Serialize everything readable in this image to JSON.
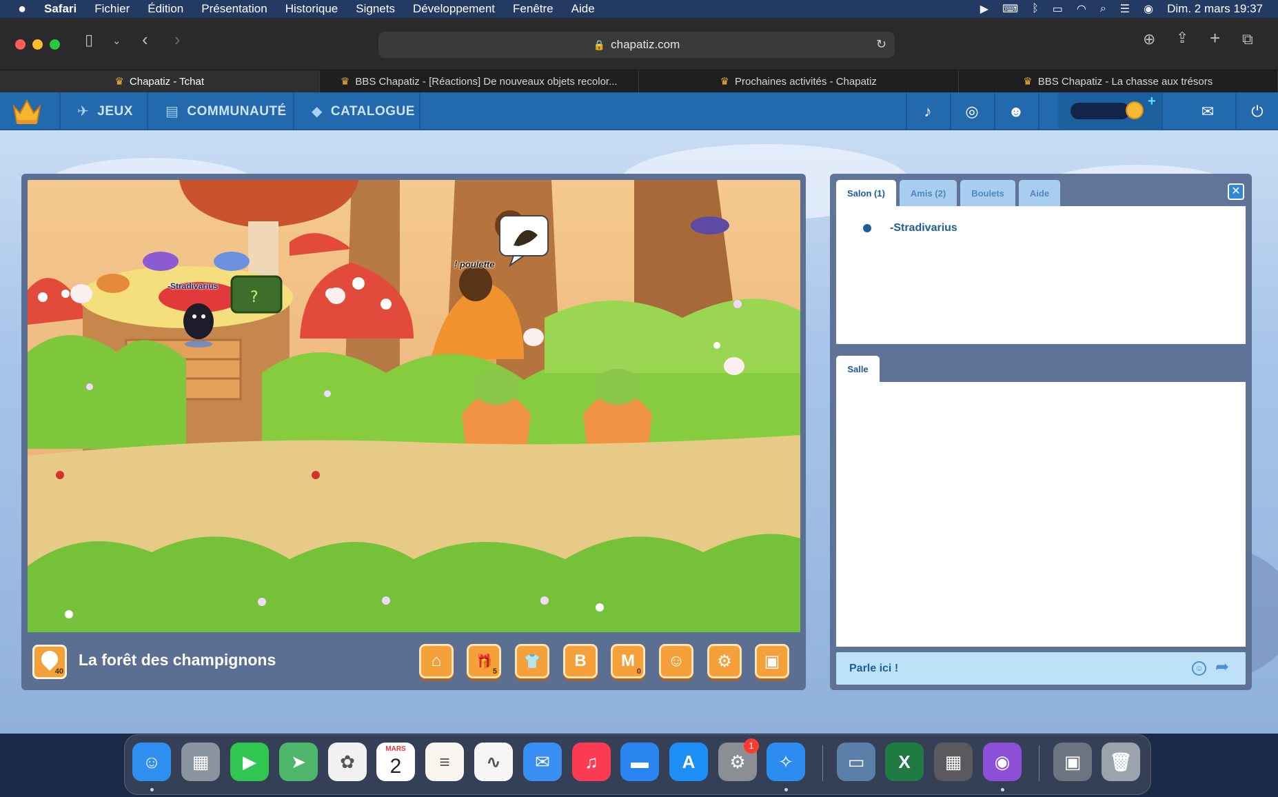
{
  "menubar": {
    "app_name": "Safari",
    "items": [
      "Fichier",
      "Édition",
      "Présentation",
      "Historique",
      "Signets",
      "Développement",
      "Fenêtre",
      "Aide"
    ],
    "datetime": "Dim. 2 mars  19:37"
  },
  "browser": {
    "url": "chapatiz.com",
    "tabs": [
      {
        "title": "Chapatiz - Tchat",
        "active": true
      },
      {
        "title": "BBS Chapatiz - [Réactions] De nouveaux objets recolor...",
        "active": false
      },
      {
        "title": "Prochaines activités - Chapatiz",
        "active": false
      },
      {
        "title": "BBS Chapatiz - La chasse aux trésors",
        "active": false
      }
    ]
  },
  "site_nav": {
    "items": [
      {
        "label": "JEUX",
        "icon": "rocket-icon"
      },
      {
        "label": "COMMUNAUTÉ",
        "icon": "box-icon"
      },
      {
        "label": "CATALOGUE",
        "icon": "tag-icon"
      }
    ],
    "social": [
      "tiktok-icon",
      "instagram-icon",
      "discord-icon"
    ],
    "right": [
      "mail-icon",
      "power-icon"
    ]
  },
  "game": {
    "room_name": "La forêt des champignons",
    "level": "40",
    "player_name": "-Stradivarius",
    "npc_name": "! poulette",
    "toolbar": [
      {
        "name": "home-icon",
        "glyph": "⌂",
        "badge": ""
      },
      {
        "name": "gift-icon",
        "glyph": "🎁",
        "badge": "5"
      },
      {
        "name": "shirt-icon",
        "glyph": "👕",
        "badge": ""
      },
      {
        "name": "b-icon",
        "glyph": "B",
        "badge": ""
      },
      {
        "name": "m-icon",
        "glyph": "M",
        "badge": "0"
      },
      {
        "name": "penguin-icon",
        "glyph": "☺",
        "badge": ""
      },
      {
        "name": "gear-icon",
        "glyph": "⚙",
        "badge": ""
      },
      {
        "name": "camera-icon",
        "glyph": "▣",
        "badge": ""
      }
    ]
  },
  "chat": {
    "tabs": [
      {
        "label": "Salon (1)",
        "active": true
      },
      {
        "label": "Amis (2)",
        "active": false
      },
      {
        "label": "Boulets",
        "active": false
      },
      {
        "label": "Aide",
        "active": false
      }
    ],
    "users": [
      "-Stradivarius"
    ],
    "room_tab": "Salle",
    "input_placeholder": "Parle ici !"
  },
  "dock": {
    "calendar_month": "MARS",
    "calendar_day": "2",
    "settings_badge": "1",
    "apps": [
      {
        "name": "finder-app",
        "color": "#2f8ff0",
        "glyph": "☺"
      },
      {
        "name": "launchpad-app",
        "color": "#8a93a0",
        "glyph": "▦"
      },
      {
        "name": "facetime-app",
        "color": "#31c552",
        "glyph": "▶"
      },
      {
        "name": "maps-app",
        "color": "#4fb56a",
        "glyph": "➤"
      },
      {
        "name": "photos-app",
        "color": "#f1f1f1",
        "glyph": "✿"
      },
      {
        "name": "calendar-app",
        "color": "#ffffff",
        "glyph": ""
      },
      {
        "name": "notes-app",
        "color": "#f7f5ee",
        "glyph": "≡"
      },
      {
        "name": "freeform-app",
        "color": "#f6f6f6",
        "glyph": "∿"
      },
      {
        "name": "mail-app",
        "color": "#3a8ff5",
        "glyph": "✉"
      },
      {
        "name": "music-app",
        "color": "#fb3b54",
        "glyph": "♫"
      },
      {
        "name": "keynote-app",
        "color": "#2a85f0",
        "glyph": "▬"
      },
      {
        "name": "appstore-app",
        "color": "#1d8ef5",
        "glyph": "A"
      },
      {
        "name": "settings-app",
        "color": "#8b8e93",
        "glyph": "⚙"
      },
      {
        "name": "safari-app",
        "color": "#2d8cf0",
        "glyph": "✧"
      },
      {
        "name": "preview-app",
        "color": "#5b7fa8",
        "glyph": "▭"
      },
      {
        "name": "excel-app",
        "color": "#1f7a43",
        "glyph": "X"
      },
      {
        "name": "calculator-app",
        "color": "#5a5a5e",
        "glyph": "▦"
      },
      {
        "name": "colorpicker-app",
        "color": "#8d4fd6",
        "glyph": "◉"
      },
      {
        "name": "screenshot-app",
        "color": "#6b7480",
        "glyph": "▣"
      },
      {
        "name": "trash-app",
        "color": "#9ba3ad",
        "glyph": "🗑"
      }
    ]
  }
}
